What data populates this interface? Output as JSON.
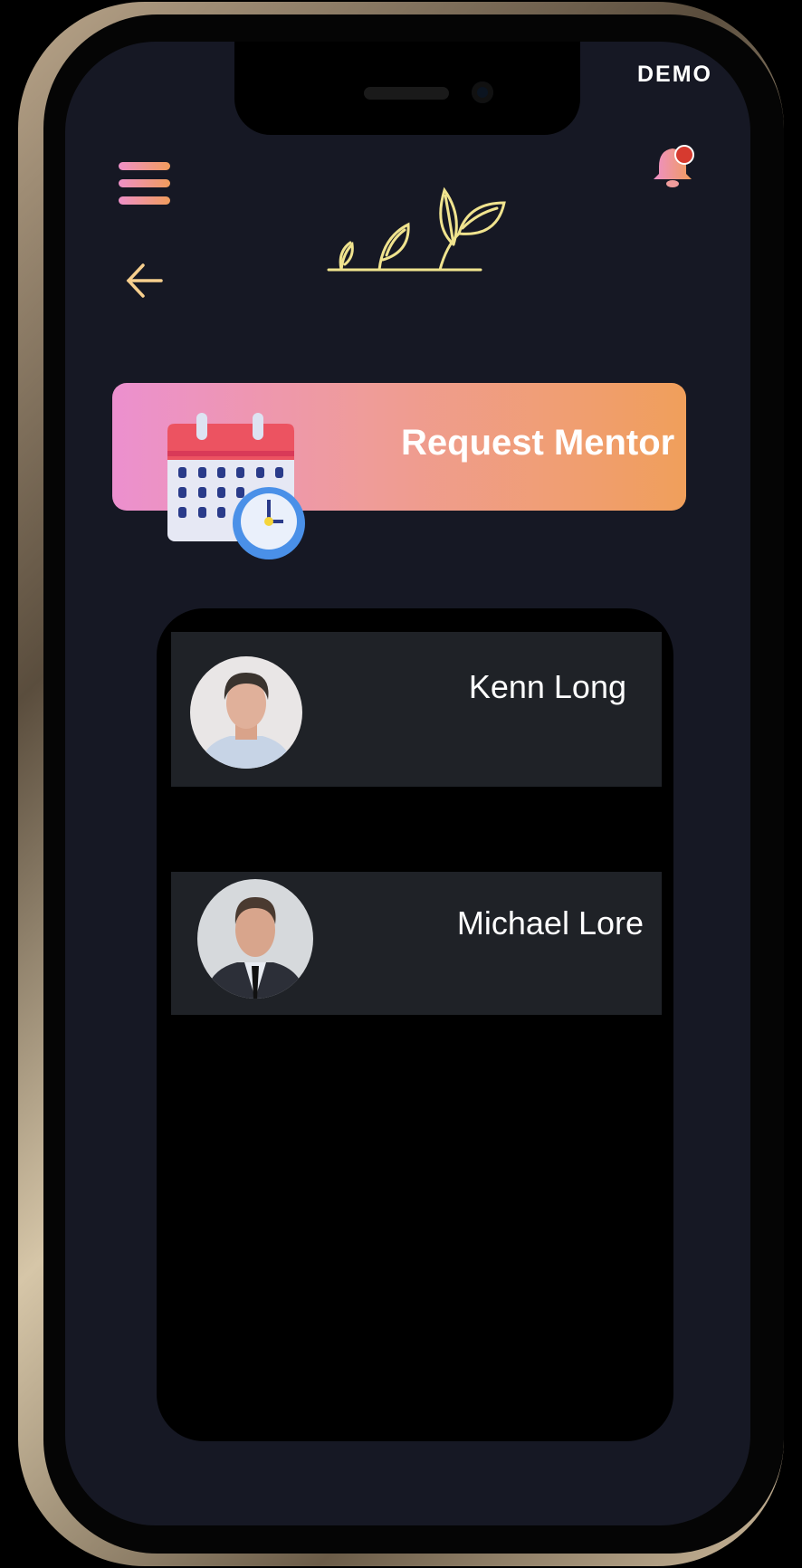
{
  "status_bar": {
    "label": "DEMO"
  },
  "header": {
    "menu_icon": "hamburger-menu-icon",
    "logo_icon": "sprouting-plants-logo",
    "notification_icon": "bell-with-badge-icon",
    "back_icon": "arrow-left-icon"
  },
  "request_button": {
    "label": "Request Mentor",
    "icon": "calendar-clock-icon"
  },
  "mentors": [
    {
      "name": "Kenn Long"
    },
    {
      "name": "Michael Lore"
    }
  ],
  "colors": {
    "background": "#161824",
    "row": "#1f2227",
    "accent_pink": "#ec90cf",
    "accent_orange": "#f09f5b",
    "logo": "#f0e38e",
    "badge": "#d63a2f"
  }
}
